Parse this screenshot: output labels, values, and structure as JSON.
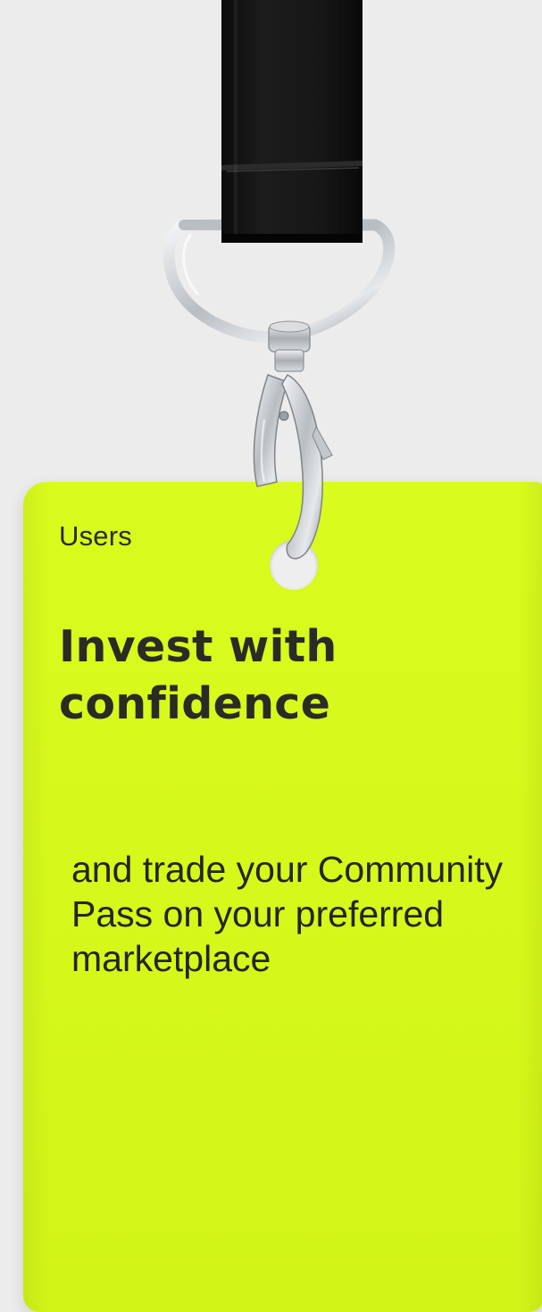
{
  "card": {
    "eyebrow": "Users",
    "title": "Invest with confidence",
    "body": "and trade your Community Pass on your preferred marketplace"
  },
  "colors": {
    "background": "#ececec",
    "card_accent": "#d8fa1c",
    "text_dark": "#2a2b25",
    "strap": "#111111",
    "metal": "#cfd3d7"
  },
  "icons": {
    "strap": "lanyard-strap-icon",
    "ring": "d-ring-icon",
    "clip": "lobster-clasp-icon",
    "hole": "card-punch-hole-icon"
  }
}
